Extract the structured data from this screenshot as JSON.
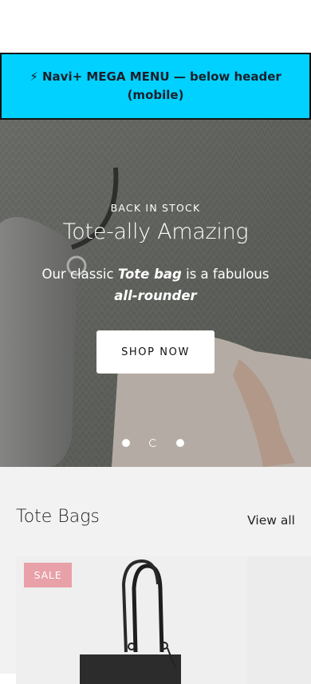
{
  "mega_menu": {
    "text": "⚡ Navi+ MEGA MENU — below header (mobile)"
  },
  "hero": {
    "eyebrow": "BACK IN STOCK",
    "headline": "Tote-ally Amazing",
    "subtext_before": "Our classic ",
    "subtext_bold1": "Tote bag",
    "subtext_middle": " is a fabulous ",
    "subtext_bold2": "all-rounder",
    "cta_label": "SHOP NOW",
    "slides_count": 3,
    "active_slide": 2
  },
  "collection": {
    "title": "Tote Bags",
    "view_all": "View all",
    "products": [
      {
        "badge": "SALE"
      }
    ]
  },
  "colors": {
    "mega_bg": "#00d1ff",
    "sale_badge": "#e8a1a8",
    "section_bg": "#f2f2f2"
  }
}
